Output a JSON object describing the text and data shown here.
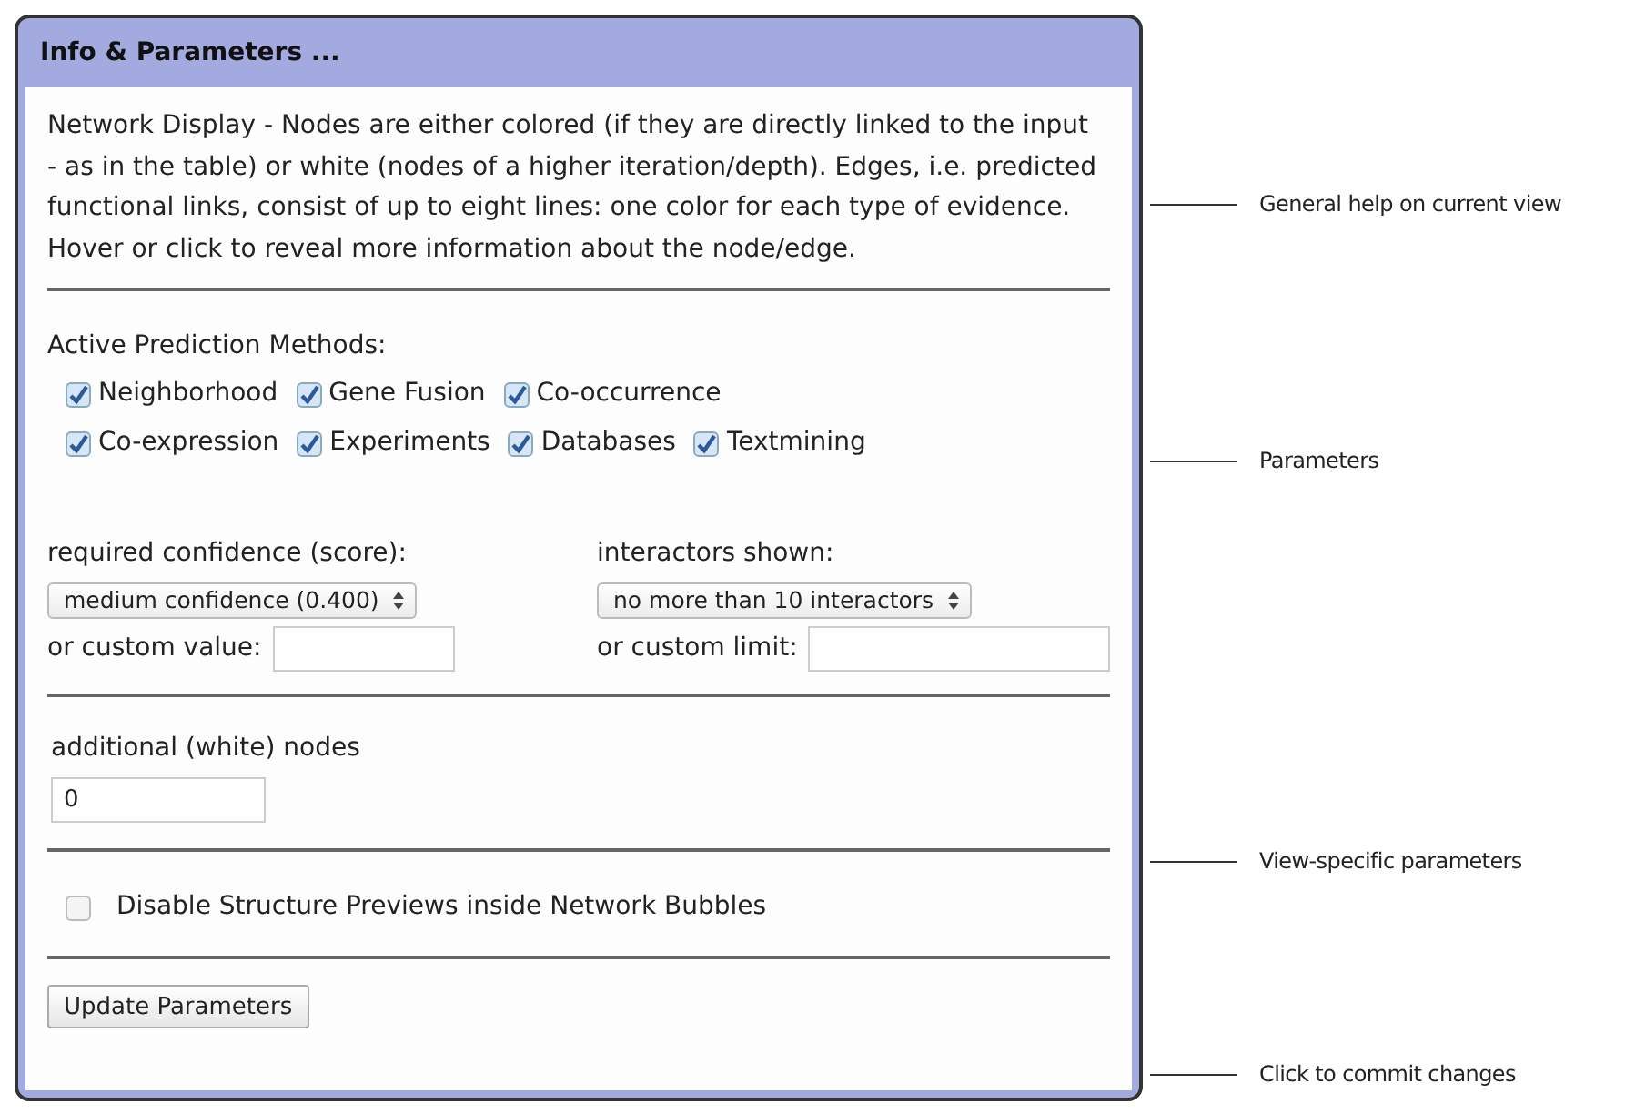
{
  "panel": {
    "title": "Info & Parameters ..."
  },
  "description": "Network Display - Nodes are either colored (if they are directly linked to the input - as in the table) or white (nodes of a higher iteration/depth). Edges, i.e. predicted functional links, consist of up to eight lines: one color for each type of evidence. Hover or click to reveal more information about the node/edge.",
  "methods": {
    "label": "Active Prediction Methods:",
    "rows": [
      [
        {
          "label": "Neighborhood",
          "checked": true
        },
        {
          "label": "Gene Fusion",
          "checked": true
        },
        {
          "label": "Co-occurrence",
          "checked": true
        }
      ],
      [
        {
          "label": "Co-expression",
          "checked": true
        },
        {
          "label": "Experiments",
          "checked": true
        },
        {
          "label": "Databases",
          "checked": true
        },
        {
          "label": "Textmining",
          "checked": true
        }
      ]
    ]
  },
  "confidence": {
    "label": "required confidence (score):",
    "select": "medium confidence (0.400)",
    "custom_label": "or custom value:"
  },
  "interactors": {
    "label": "interactors shown:",
    "select": "no more than 10 interactors",
    "custom_label": "or custom limit:"
  },
  "additional_nodes": {
    "label": "additional (white) nodes",
    "value": "0"
  },
  "structure_previews": {
    "label": "Disable Structure Previews inside Network Bubbles",
    "checked": false
  },
  "update_button": "Update Parameters",
  "annotations": [
    {
      "text": "General help on current view"
    },
    {
      "text": "Parameters"
    },
    {
      "text": "View-specific parameters"
    },
    {
      "text": "Click to commit changes"
    }
  ]
}
